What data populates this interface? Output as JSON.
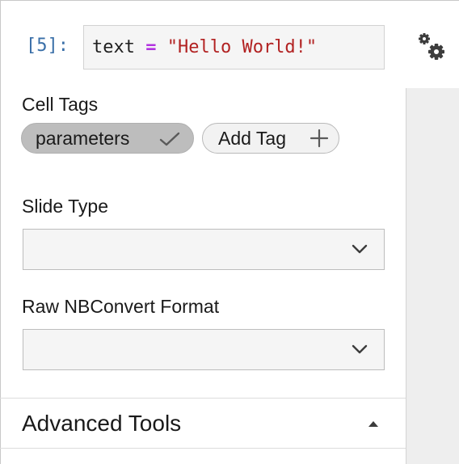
{
  "cell": {
    "prompt": "[5]:",
    "code": {
      "var": "text",
      "op": "=",
      "str": "\"Hello World!\""
    }
  },
  "icons": {
    "settings": "gears-icon",
    "tag_selected": "checkmark-icon",
    "tag_add": "plus-icon",
    "select": "chevron-down-icon",
    "collapse": "caret-up-icon"
  },
  "tags": {
    "label": "Cell Tags",
    "items": [
      {
        "label": "parameters",
        "selected": true
      }
    ],
    "add_label": "Add Tag"
  },
  "slide_type": {
    "label": "Slide Type",
    "value": ""
  },
  "raw_format": {
    "label": "Raw NBConvert Format",
    "value": ""
  },
  "advanced": {
    "label": "Advanced Tools",
    "expanded": false
  },
  "colors": {
    "prompt": "#3a6fa8",
    "operator": "#b233e0",
    "string": "#b22222",
    "tag_selected_bg": "#bdbdbd",
    "side_panel": "#eeeeee"
  }
}
